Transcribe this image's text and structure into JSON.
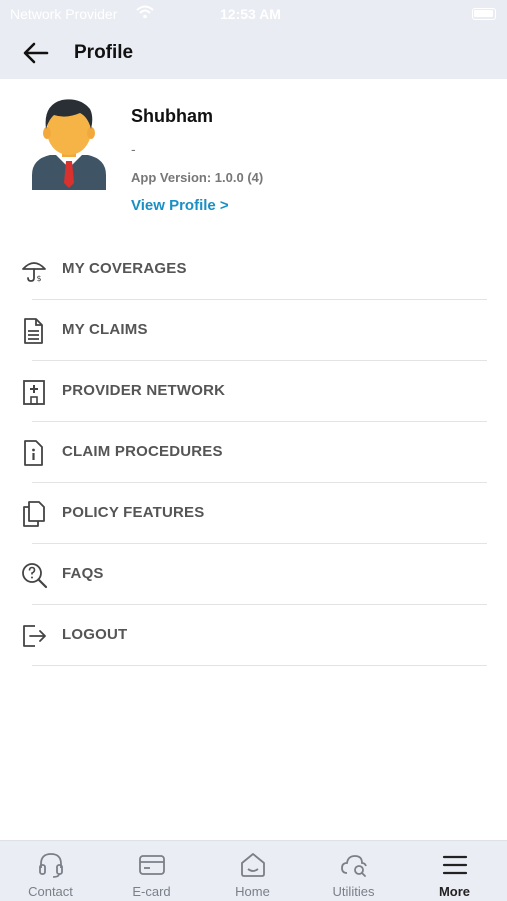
{
  "status_bar": {
    "carrier": "Network Provider",
    "time": "12:53 AM"
  },
  "header": {
    "title": "Profile"
  },
  "profile": {
    "name": "Shubham",
    "subtitle": "-",
    "app_version": "App Version: 1.0.0 (4)",
    "view_profile": "View Profile >"
  },
  "menu": {
    "items": [
      {
        "label": "MY COVERAGES",
        "icon": "umbrella-icon"
      },
      {
        "label": "MY CLAIMS",
        "icon": "document-icon"
      },
      {
        "label": "PROVIDER NETWORK",
        "icon": "hospital-icon"
      },
      {
        "label": "CLAIM PROCEDURES",
        "icon": "info-document-icon"
      },
      {
        "label": "POLICY FEATURES",
        "icon": "copy-documents-icon"
      },
      {
        "label": "FAQS",
        "icon": "search-question-icon"
      },
      {
        "label": "LOGOUT",
        "icon": "logout-icon"
      }
    ]
  },
  "tabbar": {
    "tabs": [
      {
        "label": "Contact",
        "icon": "headset-icon"
      },
      {
        "label": "E-card",
        "icon": "card-icon"
      },
      {
        "label": "Home",
        "icon": "home-icon"
      },
      {
        "label": "Utilities",
        "icon": "cloud-search-icon"
      },
      {
        "label": "More",
        "icon": "menu-icon",
        "active": true
      }
    ]
  },
  "colors": {
    "accent": "#1a8fc4",
    "header_bg": "#e9ecf2",
    "tabbar_bg": "#eaedf3"
  }
}
